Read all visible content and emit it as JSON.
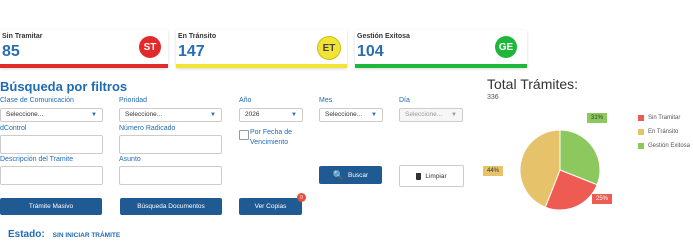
{
  "colors": {
    "red": "#e32a2a",
    "yellow": "#f1e435",
    "green": "#1db83a",
    "blue": "#1f6bb3"
  },
  "cards": [
    {
      "label": "Sin Tramitar",
      "value": "85",
      "badge": "ST"
    },
    {
      "label": "En Tránsito",
      "value": "147",
      "badge": "ET"
    },
    {
      "label": "Gestión Exitosa",
      "value": "104",
      "badge": "GE"
    }
  ],
  "filters": {
    "title": "Búsqueda por filtros",
    "clase_label": "Clase de Comunicación",
    "clase_value": "Seleccione...",
    "prioridad_label": "Prioridad",
    "prioridad_value": "Seleccione...",
    "anio_label": "Año",
    "anio_value": "2026",
    "mes_label": "Mes",
    "mes_value": "Seleccione...",
    "dia_label": "Día",
    "dia_value": "Seleccione...",
    "idcontrol_label": "dControl",
    "radicado_label": "Número Radicado",
    "vencimiento_label": "Por Fecha de Vencimiento",
    "descripcion_label": "Descripción del Tramite",
    "asunto_label": "Asunto",
    "buscar_label": "Buscar",
    "limpiar_label": "Limpiar"
  },
  "buttons": {
    "tramite_masivo": "Trámite Masivo",
    "busqueda_documentos": "Búsqueda Documentos",
    "ver_copias": "Ver Copias",
    "ver_copias_count": "0"
  },
  "estado": {
    "label": "Estado:",
    "value": "SIN INICIAR TRÁMITE"
  },
  "chart_data": {
    "type": "pie",
    "title": "Total Trámites:",
    "subtitle": "336",
    "series": [
      {
        "name": "Sin Tramitar",
        "percent": 25,
        "label": "25%",
        "color": "#ee5b52"
      },
      {
        "name": "En Tránsito",
        "percent": 44,
        "label": "44%",
        "color": "#e6c36a"
      },
      {
        "name": "Gestión Exitosa",
        "percent": 31,
        "label": "31%",
        "color": "#8dc85e"
      }
    ],
    "legend_position": "right"
  }
}
